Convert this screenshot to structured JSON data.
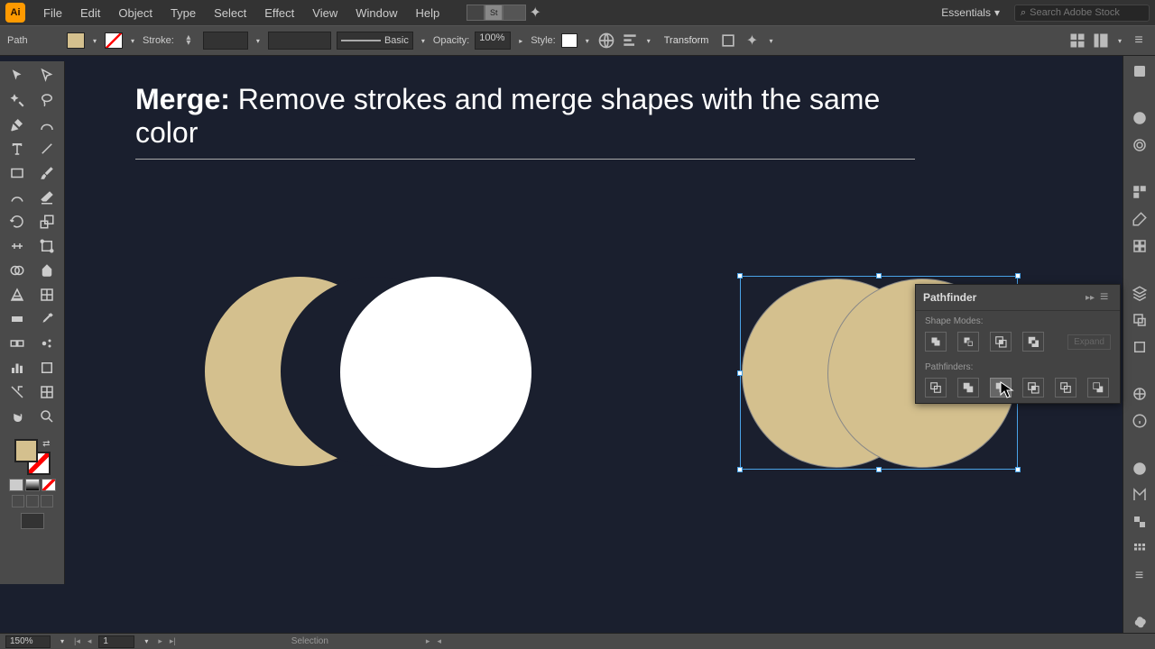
{
  "app": {
    "icon_text": "Ai"
  },
  "menu": {
    "file": "File",
    "edit": "Edit",
    "object": "Object",
    "type": "Type",
    "select": "Select",
    "effect": "Effect",
    "view": "View",
    "window": "Window",
    "help": "Help"
  },
  "menubar_right": {
    "workspace": "Essentials",
    "search_placeholder": "Search Adobe Stock"
  },
  "control": {
    "selection_label": "Path",
    "stroke_label": "Stroke:",
    "basic_label": "Basic",
    "opacity_label": "Opacity:",
    "opacity_value": "100%",
    "style_label": "Style:",
    "transform_label": "Transform"
  },
  "canvas_title": {
    "bold": "Merge:",
    "rest": " Remove strokes and merge shapes with the same color"
  },
  "colors": {
    "bg": "#1a1f2e",
    "tan": "#d4c08e",
    "white": "#ffffff",
    "selection": "#4aa3e8"
  },
  "pathfinder": {
    "title": "Pathfinder",
    "shape_modes_label": "Shape Modes:",
    "pathfinders_label": "Pathfinders:",
    "expand": "Expand",
    "active_mode": "merge"
  },
  "status": {
    "zoom": "150%",
    "page": "1",
    "tool": "Selection"
  }
}
